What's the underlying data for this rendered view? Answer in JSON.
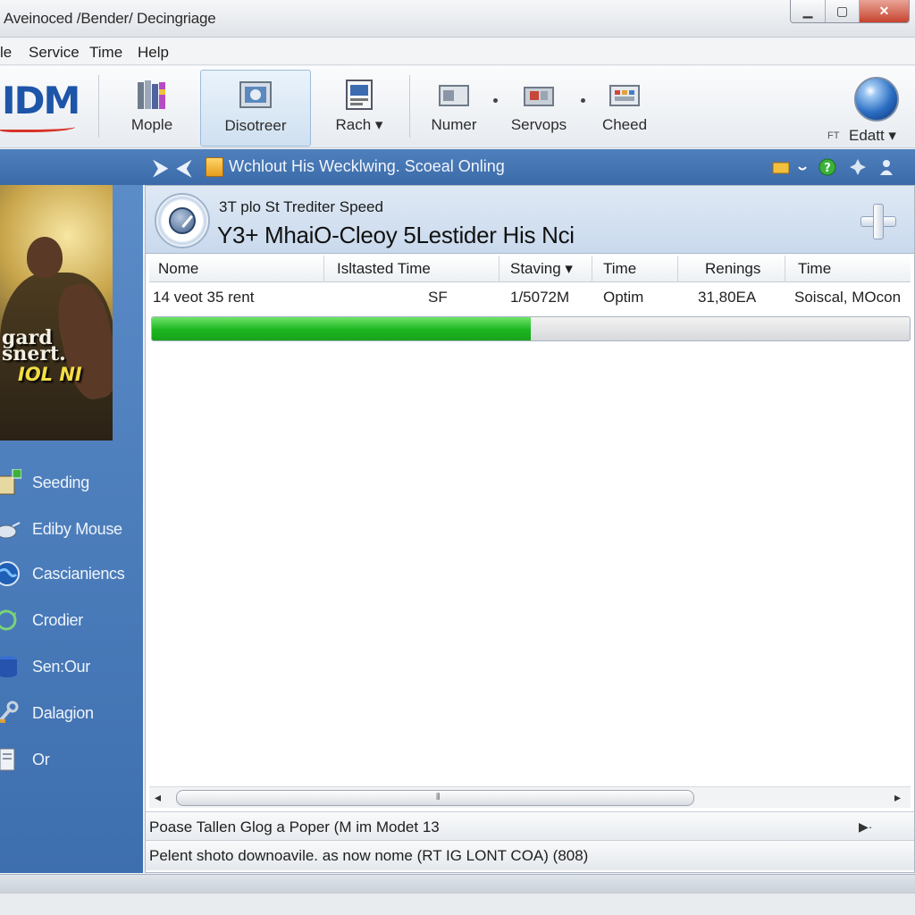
{
  "window": {
    "title": "Aveinoced /Bender/ Decingriage"
  },
  "window_controls": {
    "minimize": "▁",
    "maximize": "▢",
    "close": "✕"
  },
  "menu": [
    "le",
    "Service",
    "Time",
    "Help"
  ],
  "logo": {
    "text": "IDM"
  },
  "toolbar": {
    "buttons": [
      {
        "label": "Mople",
        "icon": "books-icon"
      },
      {
        "label": "Disotreer",
        "icon": "picture-icon"
      },
      {
        "label": "Rach ▾",
        "icon": "document-icon"
      },
      {
        "label": "Numer",
        "icon": "queue-icon"
      },
      {
        "label": "Servops",
        "icon": "toolbox-icon"
      },
      {
        "label": "Cheed",
        "icon": "grid-icon"
      }
    ],
    "ft_label": "FT",
    "edit_label": "Edatt ▾"
  },
  "navbar": {
    "path": "Wchlout His Wecklwing. Scoeal Onling",
    "forward": "⮞",
    "back": "⮜"
  },
  "sidebar": {
    "poster": {
      "title": "gard\nsnert.",
      "subtitle": "IOL NI"
    },
    "items": [
      {
        "label": "Seeding",
        "icon": "seeding-icon"
      },
      {
        "label": "Ediby Mouse",
        "icon": "mouse-icon"
      },
      {
        "label": "Cascianiencs",
        "icon": "globe-icon"
      },
      {
        "label": "Crodier",
        "icon": "cycle-icon"
      },
      {
        "label": "Sen:Our",
        "icon": "database-icon"
      },
      {
        "label": "Dalagion",
        "icon": "tools-icon"
      },
      {
        "label": "Or",
        "icon": "page-icon"
      }
    ]
  },
  "download": {
    "subtitle": "3T plo St Trediter Speed",
    "title": "Y3+ MhaiO-Cleoy 5Lestider His Nci"
  },
  "table": {
    "columns": [
      "Nome",
      "Isltasted Time",
      "Staving ▾",
      "Time",
      "Renings",
      "Time"
    ],
    "row": [
      "14 veot 35 rent",
      "SF",
      "1/5072M",
      "Optim",
      "31,80EA",
      "Soiscal, MOcon"
    ]
  },
  "progress": 0.5,
  "status": {
    "line1": "Poase Tallen Glog a Poper (M im Modet 13",
    "line2": "Pelent shoto downoavile. as now nome (RT IG LONT COA) (808)"
  },
  "colors": {
    "accent": "#3b6aa8",
    "progress": "#1cb51f",
    "close_button": "#c7432f"
  }
}
